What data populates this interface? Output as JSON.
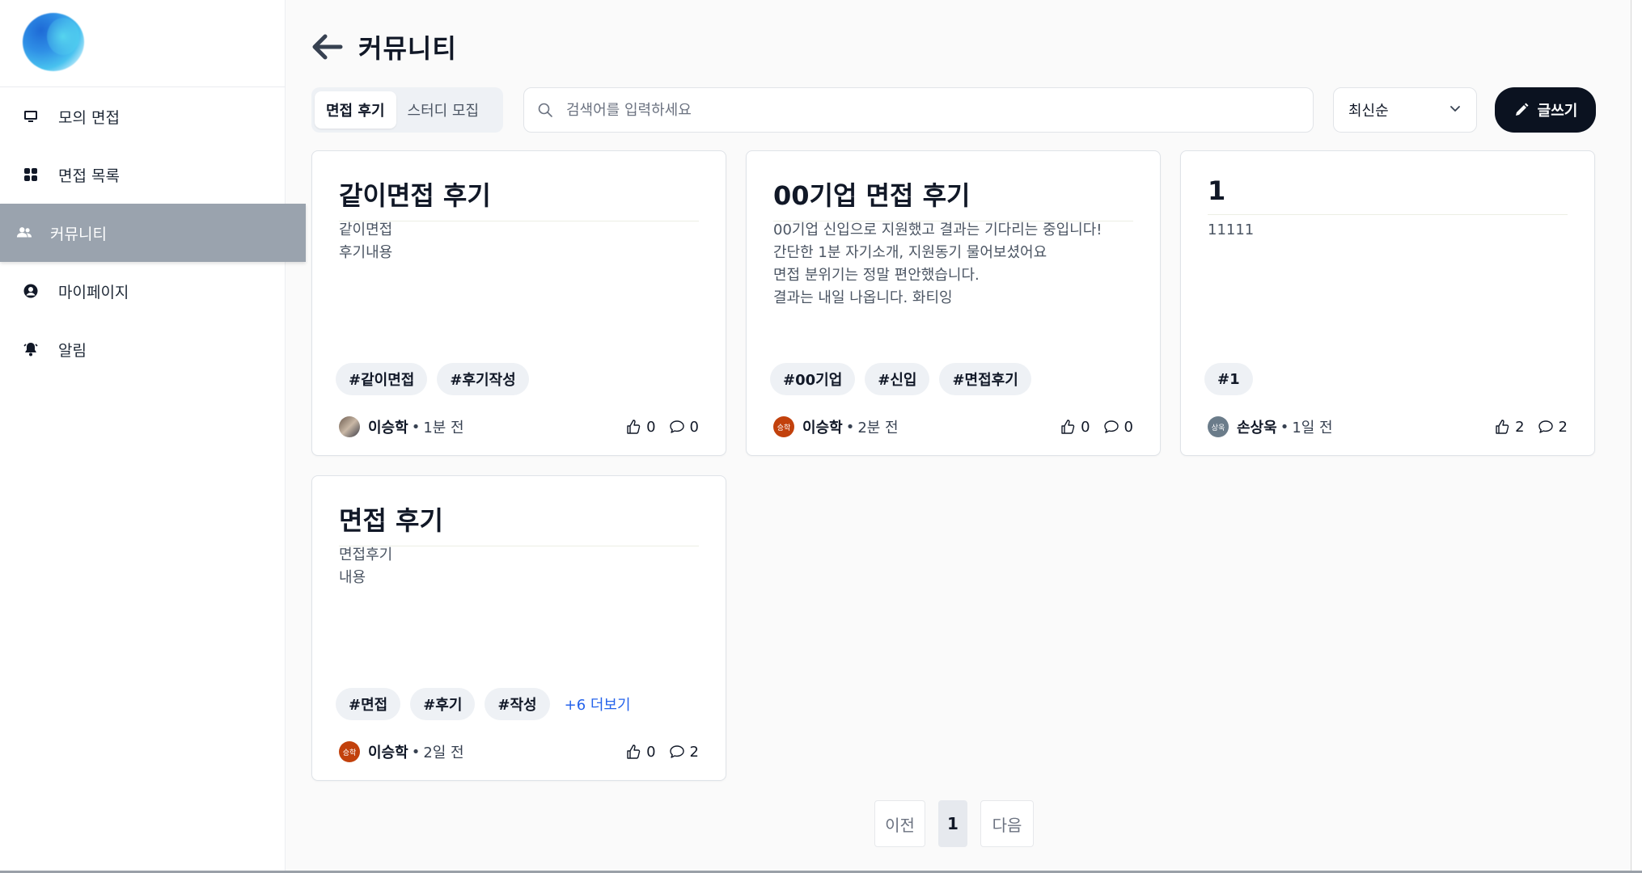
{
  "sidebar": {
    "items": [
      {
        "label": "모의 면접",
        "icon": "monitor-icon"
      },
      {
        "label": "면접 목록",
        "icon": "grid-icon"
      },
      {
        "label": "커뮤니티",
        "icon": "users-icon",
        "active": true
      },
      {
        "label": "마이페이지",
        "icon": "user-circle-icon"
      },
      {
        "label": "알림",
        "icon": "bell-icon"
      }
    ]
  },
  "header": {
    "title": "커뮤니티"
  },
  "toolbar": {
    "tabs": [
      {
        "label": "면접 후기",
        "active": true
      },
      {
        "label": "스터디 모집"
      }
    ],
    "search_placeholder": "검색어를 입력하세요",
    "sort_label": "최신순",
    "write_label": "글쓰기"
  },
  "cards": [
    {
      "title": "같이면접 후기",
      "body": [
        "같이면접",
        "후기내용"
      ],
      "tags": [
        "#같이면접",
        "#후기작성"
      ],
      "more": "",
      "author": "이승학",
      "time": "1분 전",
      "avatar_text": "",
      "likes": "0",
      "comments": "0"
    },
    {
      "title": "00기업 면접 후기",
      "body": [
        "00기업 신입으로 지원했고 결과는 기다리는 중입니다!",
        "간단한 1분 자기소개, 지원동기 물어보셨어요",
        "면접 분위기는 정말 편안했습니다.",
        "결과는 내일 나옵니다. 화티잉"
      ],
      "tags": [
        "#00기업",
        "#신입",
        "#면접후기"
      ],
      "more": "",
      "author": "이승학",
      "time": "2분 전",
      "avatar_text": "승학",
      "likes": "0",
      "comments": "0"
    },
    {
      "title": "1",
      "body": [
        "11111"
      ],
      "tags": [
        "#1"
      ],
      "more": "",
      "author": "손상욱",
      "time": "1일 전",
      "avatar_text": "상욱",
      "likes": "2",
      "comments": "2"
    },
    {
      "title": "면접 후기",
      "body": [
        "면접후기",
        "내용"
      ],
      "tags": [
        "#면접",
        "#후기",
        "#작성"
      ],
      "more": "+6 더보기",
      "author": "이승학",
      "time": "2일 전",
      "avatar_text": "승학",
      "likes": "0",
      "comments": "2"
    }
  ],
  "pagination": {
    "prev": "이전",
    "current": "1",
    "next": "다음"
  },
  "colors": {
    "accent_dark": "#0b1220",
    "sidebar_active": "#9aa3ae",
    "link": "#2563eb"
  }
}
